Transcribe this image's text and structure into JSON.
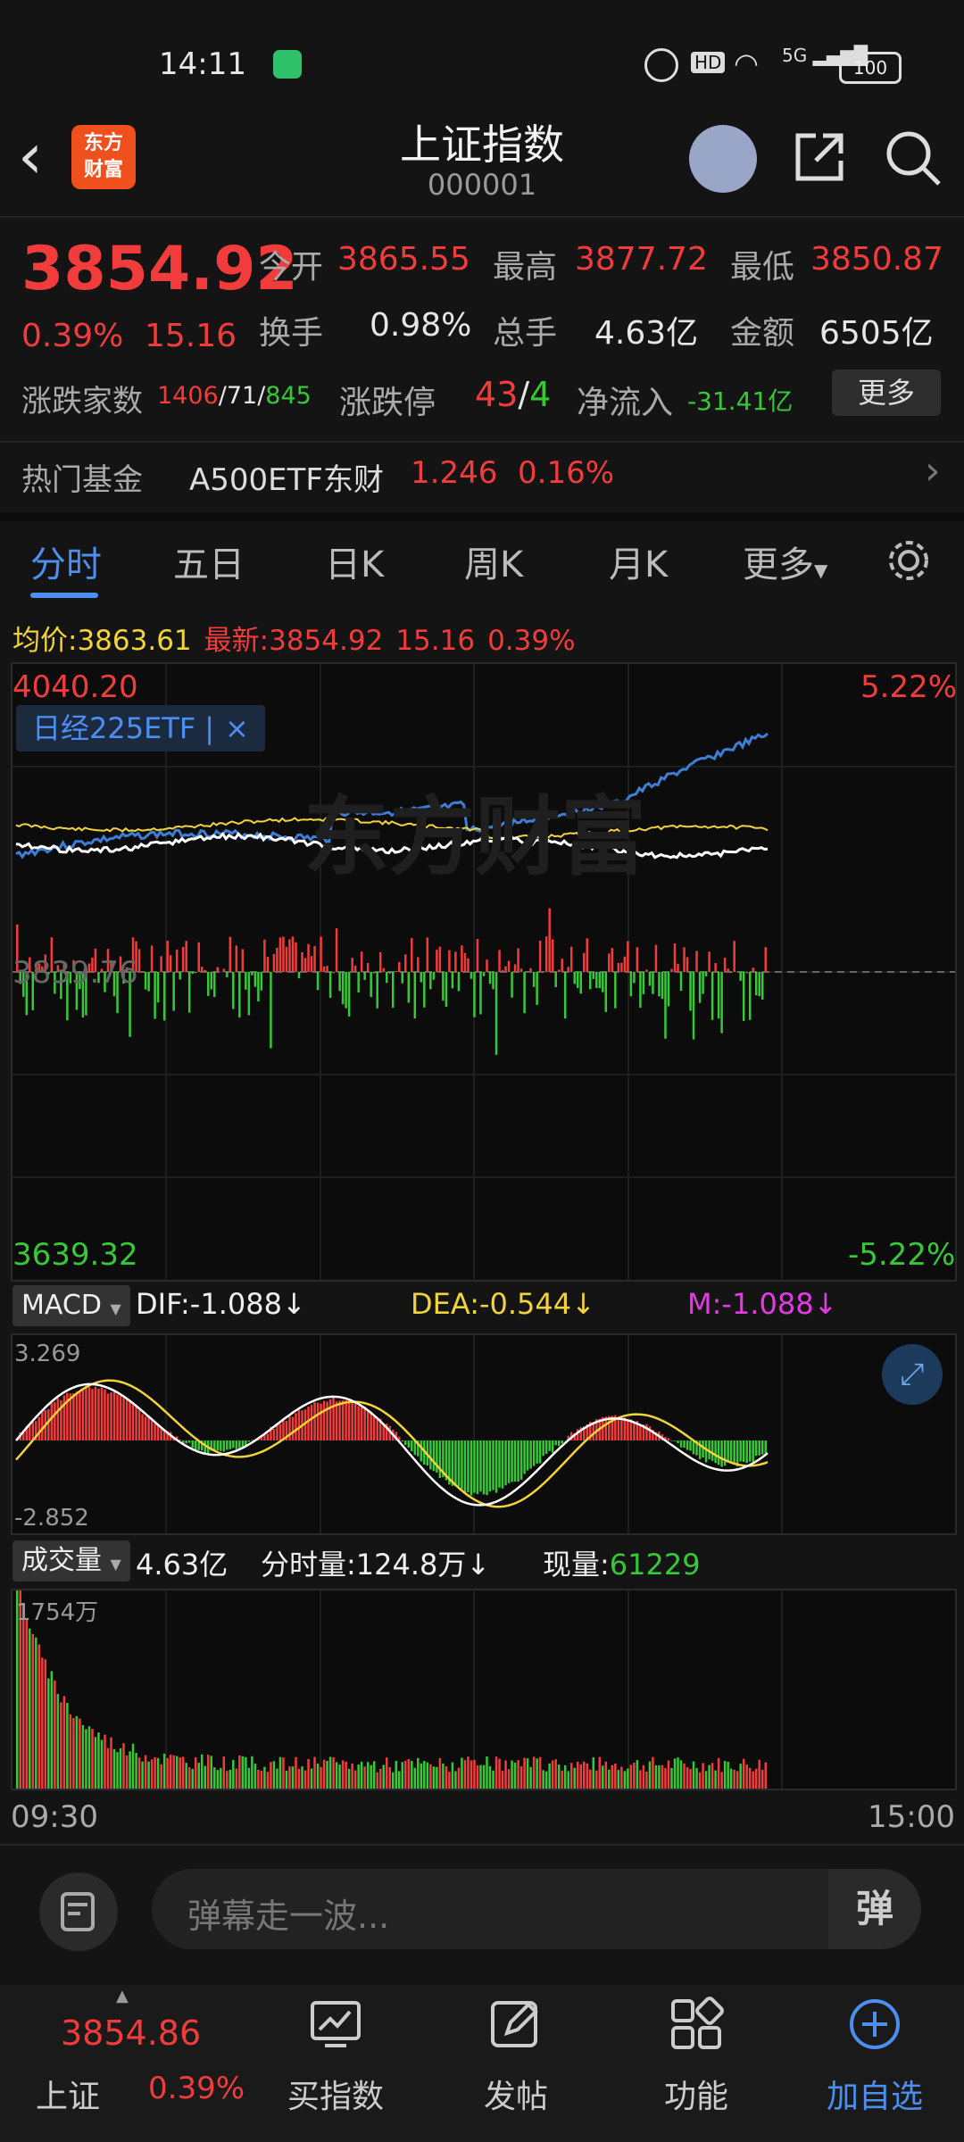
{
  "status_bar": {
    "time": "14:11",
    "battery": "100",
    "network": "5G",
    "hd": "HD"
  },
  "header": {
    "logo_text_line1": "东方",
    "logo_text_line2": "财富",
    "title": "上证指数",
    "code": "000001"
  },
  "quote": {
    "price": "3854.92",
    "change_pct": "0.39%",
    "change": "15.16",
    "open_label": "今开",
    "open": "3865.55",
    "high_label": "最高",
    "high": "3877.72",
    "low_label": "最低",
    "low": "3850.87",
    "turnover_label": "换手",
    "turnover": "0.98%",
    "volume_label": "总手",
    "volume": "4.63亿",
    "amount_label": "金额",
    "amount": "6505亿",
    "breadth_label": "涨跌家数",
    "up": "1406",
    "flat": "71",
    "down": "845",
    "sep": "/",
    "limit_label": "涨跌停",
    "limit_up": "43",
    "limit_down": "4",
    "netflow_label": "净流入",
    "netflow": "-31.41亿",
    "more_label": "更多"
  },
  "hot_fund": {
    "label": "热门基金",
    "name": "A500ETF东财",
    "price": "1.246",
    "pct": "0.16%"
  },
  "tabs": [
    {
      "label": "分时"
    },
    {
      "label": "五日"
    },
    {
      "label": "日K"
    },
    {
      "label": "周K"
    },
    {
      "label": "月K"
    },
    {
      "label": "更多"
    }
  ],
  "intraday": {
    "avg_label": "均价:",
    "avg": "3863.61",
    "last_label": "最新:",
    "last": "3854.92",
    "change": "15.16",
    "pct": "0.39%",
    "top_price": "4040.20",
    "top_pct": "5.22%",
    "bottom_price": "3639.32",
    "bottom_pct": "-5.22%",
    "mid_price": "3839.76",
    "compare_tag": "日经225ETF",
    "compare_close": "×",
    "watermark": "东方财富"
  },
  "macd": {
    "select": "MACD",
    "dif": "DIF:-1.088",
    "dea": "DEA:-0.544",
    "m": "M:-1.088",
    "arrow": "↓",
    "max": "3.269",
    "min": "-2.852"
  },
  "vol": {
    "select": "成交量",
    "total": "4.63亿",
    "minute_label": "分时量:124.8万",
    "arrow": "↓",
    "now_label": "现量:",
    "now": "61229",
    "max": "1754万",
    "start_time": "09:30",
    "end_time": "15:00"
  },
  "comment": {
    "placeholder": "弹幕走一波...",
    "barrage_glyph": "弹"
  },
  "bottom_nav": {
    "index_name": "上证",
    "index_price": "3854.86",
    "index_pct": "0.39%",
    "items": [
      {
        "label": "买指数"
      },
      {
        "label": "发帖"
      },
      {
        "label": "功能"
      },
      {
        "label": "加自选"
      }
    ]
  },
  "colors": {
    "up": "#f23b3b",
    "down": "#37c837",
    "accent": "#4d8ff0",
    "avg_line": "#f2d33a",
    "price_line": "#ffffff",
    "compare_line": "#3d7fd6"
  }
}
